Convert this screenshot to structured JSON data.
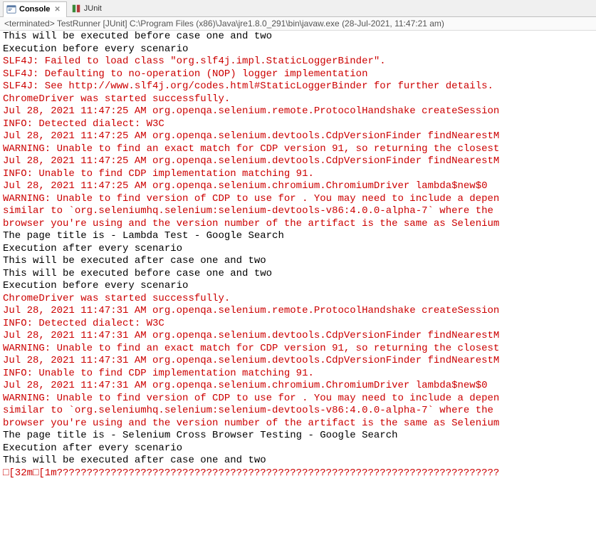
{
  "tabs": {
    "console": {
      "label": "Console",
      "active": true
    },
    "junit": {
      "label": "JUnit",
      "active": false
    }
  },
  "status": {
    "prefix": "<terminated>",
    "runner": "TestRunner [JUnit]",
    "path": "C:\\Program Files (x86)\\Java\\jre1.8.0_291\\bin\\javaw.exe",
    "stamp": "(28-Jul-2021, 11:47:21 am)"
  },
  "console_lines": [
    {
      "s": "out",
      "t": "This will be executed before case one and two"
    },
    {
      "s": "out",
      "t": "Execution before every scenario"
    },
    {
      "s": "err",
      "t": "SLF4J: Failed to load class \"org.slf4j.impl.StaticLoggerBinder\"."
    },
    {
      "s": "err",
      "t": "SLF4J: Defaulting to no-operation (NOP) logger implementation"
    },
    {
      "s": "err",
      "t": "SLF4J: See http://www.slf4j.org/codes.html#StaticLoggerBinder for further details."
    },
    {
      "s": "err",
      "t": "ChromeDriver was started successfully."
    },
    {
      "s": "err",
      "t": "Jul 28, 2021 11:47:25 AM org.openqa.selenium.remote.ProtocolHandshake createSession"
    },
    {
      "s": "err",
      "t": "INFO: Detected dialect: W3C"
    },
    {
      "s": "err",
      "t": "Jul 28, 2021 11:47:25 AM org.openqa.selenium.devtools.CdpVersionFinder findNearestM"
    },
    {
      "s": "err",
      "t": "WARNING: Unable to find an exact match for CDP version 91, so returning the closest"
    },
    {
      "s": "err",
      "t": "Jul 28, 2021 11:47:25 AM org.openqa.selenium.devtools.CdpVersionFinder findNearestM"
    },
    {
      "s": "err",
      "t": "INFO: Unable to find CDP implementation matching 91."
    },
    {
      "s": "err",
      "t": "Jul 28, 2021 11:47:25 AM org.openqa.selenium.chromium.ChromiumDriver lambda$new$0"
    },
    {
      "s": "err",
      "t": "WARNING: Unable to find version of CDP to use for . You may need to include a depen"
    },
    {
      "s": "err",
      "t": "similar to `org.seleniumhq.selenium:selenium-devtools-v86:4.0.0-alpha-7` where the "
    },
    {
      "s": "err",
      "t": "browser you're using and the version number of the artifact is the same as Selenium"
    },
    {
      "s": "out",
      "t": "The page title is - Lambda Test - Google Search"
    },
    {
      "s": "out",
      "t": "Execution after every scenario"
    },
    {
      "s": "out",
      "t": "This will be executed after case one and two"
    },
    {
      "s": "out",
      "t": "This will be executed before case one and two"
    },
    {
      "s": "out",
      "t": "Execution before every scenario"
    },
    {
      "s": "err",
      "t": "ChromeDriver was started successfully."
    },
    {
      "s": "err",
      "t": "Jul 28, 2021 11:47:31 AM org.openqa.selenium.remote.ProtocolHandshake createSession"
    },
    {
      "s": "err",
      "t": "INFO: Detected dialect: W3C"
    },
    {
      "s": "err",
      "t": "Jul 28, 2021 11:47:31 AM org.openqa.selenium.devtools.CdpVersionFinder findNearestM"
    },
    {
      "s": "err",
      "t": "WARNING: Unable to find an exact match for CDP version 91, so returning the closest"
    },
    {
      "s": "err",
      "t": "Jul 28, 2021 11:47:31 AM org.openqa.selenium.devtools.CdpVersionFinder findNearestM"
    },
    {
      "s": "err",
      "t": "INFO: Unable to find CDP implementation matching 91."
    },
    {
      "s": "err",
      "t": "Jul 28, 2021 11:47:31 AM org.openqa.selenium.chromium.ChromiumDriver lambda$new$0"
    },
    {
      "s": "err",
      "t": "WARNING: Unable to find version of CDP to use for . You may need to include a depen"
    },
    {
      "s": "err",
      "t": "similar to `org.seleniumhq.selenium:selenium-devtools-v86:4.0.0-alpha-7` where the "
    },
    {
      "s": "err",
      "t": "browser you're using and the version number of the artifact is the same as Selenium"
    },
    {
      "s": "out",
      "t": "The page title is - Selenium Cross Browser Testing - Google Search"
    },
    {
      "s": "out",
      "t": "Execution after every scenario"
    },
    {
      "s": "out",
      "t": "This will be executed after case one and two"
    },
    {
      "s": "err",
      "t": "□[32m□[1m??????????????????????????????????????????????????????????????????????????"
    }
  ]
}
